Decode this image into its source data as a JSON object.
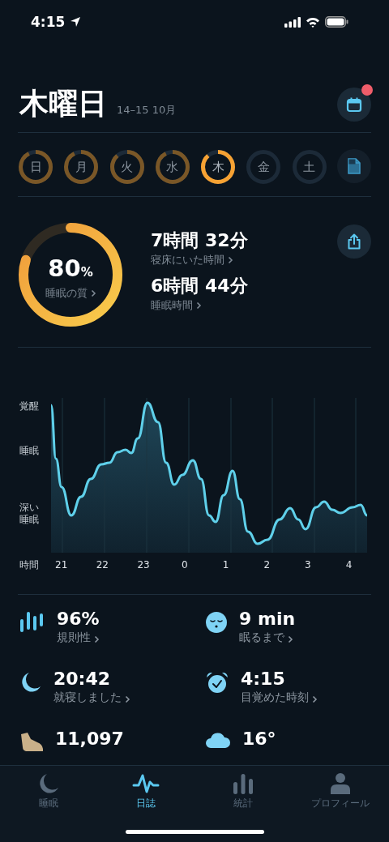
{
  "status_bar": {
    "time": "4:15"
  },
  "header": {
    "day": "木曜日",
    "dates": "14–15 10月",
    "calendar_badge": true
  },
  "days": [
    {
      "label": "日",
      "level": 0.92,
      "selected": false
    },
    {
      "label": "月",
      "level": 0.92,
      "selected": false
    },
    {
      "label": "火",
      "level": 0.88,
      "selected": false
    },
    {
      "label": "水",
      "level": 0.92,
      "selected": false
    },
    {
      "label": "木",
      "level": 0.88,
      "selected": true
    },
    {
      "label": "金",
      "level": 0,
      "selected": false
    },
    {
      "label": "土",
      "level": 0,
      "selected": false
    }
  ],
  "summary": {
    "quality": {
      "value": "80",
      "unit": "%",
      "label": "睡眠の質",
      "level": 0.8
    },
    "stats": [
      {
        "value": "7時間 32分",
        "label": "寝床にいた時間"
      },
      {
        "value": "6時間 44分",
        "label": "睡眠時間"
      }
    ]
  },
  "chart": {
    "y_labels": [
      "覚醒",
      "睡眠",
      "深い睡眠"
    ],
    "time_label": "時間",
    "x_labels": [
      "21",
      "22",
      "23",
      "0",
      "1",
      "2",
      "3",
      "4"
    ]
  },
  "metrics": [
    {
      "kind": "regularity",
      "value": "96%",
      "label": "規則性"
    },
    {
      "kind": "fall_asleep",
      "value": "9 min",
      "label": "眠るまで"
    },
    {
      "kind": "bedtime",
      "value": "20:42",
      "label": "就寝しました"
    },
    {
      "kind": "wake",
      "value": "4:15",
      "label": "目覚めた時刻"
    },
    {
      "kind": "steps",
      "value": "11,097"
    },
    {
      "kind": "weather",
      "value": "16°"
    }
  ],
  "tabs": [
    {
      "kind": "sleep",
      "label": "睡眠",
      "selected": false
    },
    {
      "kind": "journal",
      "label": "日誌",
      "selected": true
    },
    {
      "kind": "stats",
      "label": "統計",
      "selected": false
    },
    {
      "kind": "profile",
      "label": "プロフィール",
      "selected": false
    }
  ]
}
